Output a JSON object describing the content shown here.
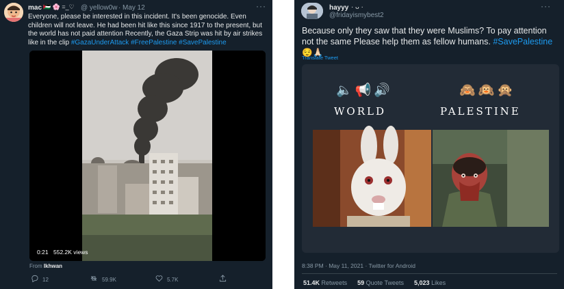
{
  "left_tweet": {
    "display_name": "mac",
    "name_emojis": "🇵🇸 🌸 =_♡",
    "handle": "@ yellow0w",
    "separator": "·",
    "date": "May 12",
    "more": "···",
    "text": "Everyone, please be interested in this incident. It's been genocide. Even children will not leave. He had been hit like this since 1917 to the present, but the world has not paid attention Recently, the Gaza Strip was hit by air strikes like in the clip",
    "hashtags": [
      "#GazaUnderAttack",
      "#FreePalestine",
      "#SavePalestine"
    ],
    "video": {
      "time": "0:21",
      "views": "552.2K views"
    },
    "from_label": "From",
    "from_source": "Ikhwan",
    "actions": {
      "reply_count": "12",
      "retweet_count": "59.9K",
      "like_count": "5.7K"
    },
    "icons": {
      "reply": "reply-icon",
      "retweet": "retweet-icon",
      "like": "heart-icon",
      "share": "share-icon"
    }
  },
  "right_tweet": {
    "display_name": "hayyy",
    "name_suffix": "· ᴗ ·",
    "handle": "@fridayismybest2",
    "more": "···",
    "text": "Because only they saw that they were Muslims? To pay attention not the same Please help them as fellow humans.",
    "hashtag": "#SavePalestine",
    "text_emojis": "😌🙏🏻",
    "translate_label": "Translate Tweet",
    "image": {
      "left_emojis": "🔈📢🔊",
      "right_emojis": "🙈🙉🙊",
      "left_word": "WORLD",
      "right_word": "PALESTINE"
    },
    "timestamp": "8:38 PM · May 11, 2021 · Twitter for Android",
    "stats": {
      "retweets_count": "51.4K",
      "retweets_label": "Retweets",
      "quotes_count": "59",
      "quotes_label": "Quote Tweets",
      "likes_count": "5,023",
      "likes_label": "Likes"
    }
  },
  "colors": {
    "background": "#15202b",
    "text": "#e7e9ea",
    "muted": "#8899a6",
    "link": "#1d9bf0",
    "divider": "#38444d"
  }
}
